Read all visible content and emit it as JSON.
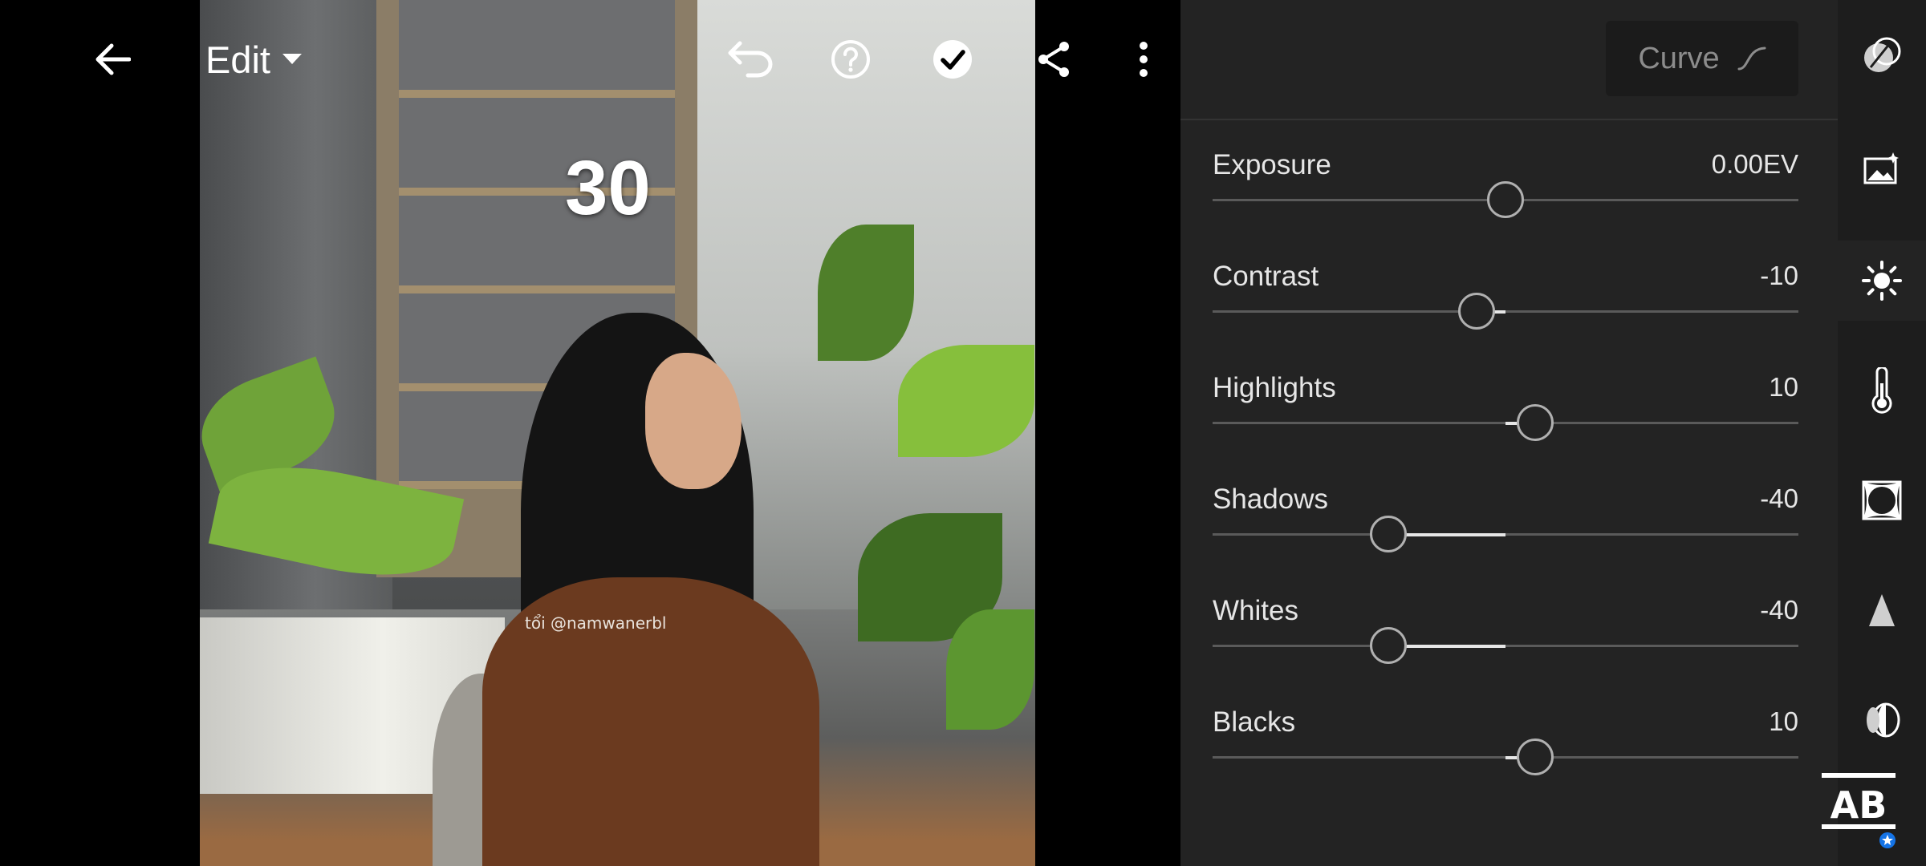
{
  "toolbar": {
    "edit_label": "Edit"
  },
  "photo": {
    "overlay_number": "30",
    "watermark": "tổi @namwanerbl"
  },
  "panel": {
    "curve_label": "Curve",
    "sliders": [
      {
        "label": "Exposure",
        "value": "0.00EV",
        "position": 0.5
      },
      {
        "label": "Contrast",
        "value": "-10",
        "position": 0.45
      },
      {
        "label": "Highlights",
        "value": "10",
        "position": 0.55
      },
      {
        "label": "Shadows",
        "value": "-40",
        "position": 0.3
      },
      {
        "label": "Whites",
        "value": "-40",
        "position": 0.3
      },
      {
        "label": "Blacks",
        "value": "10",
        "position": 0.55
      }
    ]
  },
  "rail": {
    "tools": [
      "presets-icon",
      "auto-enhance-icon",
      "light-icon",
      "color-temperature-icon",
      "effects-icon",
      "detail-icon",
      "optics-icon"
    ],
    "active_tool": "light-icon"
  },
  "colors": {
    "panel_bg": "#232323",
    "rail_bg": "#1d1d1d",
    "text": "#e6e6e6",
    "accent_blue": "#1473e6"
  }
}
